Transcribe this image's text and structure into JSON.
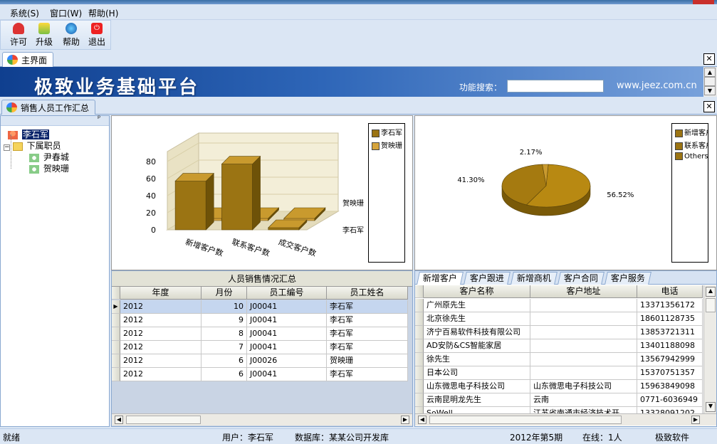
{
  "menu": {
    "items": [
      "系统(S)",
      "窗口(W)",
      "帮助(H)"
    ]
  },
  "toolbar": {
    "buttons": [
      {
        "label": "许可",
        "icon": "license-icon"
      },
      {
        "label": "升级",
        "icon": "upgrade-icon"
      },
      {
        "label": "帮助",
        "icon": "help-icon"
      },
      {
        "label": "退出",
        "icon": "exit-icon"
      }
    ]
  },
  "tabs": {
    "main": "主界面",
    "sub": "销售人员工作汇总"
  },
  "banner": {
    "title": "极致业务基础平台",
    "search_label": "功能搜索：",
    "search_value": "",
    "website": "www.jeez.com.cn"
  },
  "tree": {
    "root": "李石军",
    "group": "下属职员",
    "children": [
      "尹春城",
      "贺映珊"
    ]
  },
  "chart_data": [
    {
      "type": "bar",
      "categories": [
        "新增客户数",
        "联系客户数",
        "成交客户数"
      ],
      "series": [
        {
          "name": "李石军",
          "values": [
            57,
            77,
            2
          ],
          "color": "#9b7413"
        },
        {
          "name": "贺映珊",
          "values": [
            0,
            0,
            0
          ],
          "color": "#d6a43c"
        }
      ],
      "ylim": [
        0,
        80
      ],
      "yticks": [
        0,
        20,
        40,
        60,
        80
      ],
      "series_labels": [
        "贺映珊",
        "李石军"
      ],
      "legend": [
        "李石军",
        "贺映珊"
      ],
      "legend_position": "right",
      "style": "3d"
    },
    {
      "type": "pie",
      "labels": [
        "新增客户",
        "联系客户",
        "Others"
      ],
      "values": [
        56.52,
        41.3,
        2.17
      ],
      "value_labels": [
        "56.52%",
        "41.30%",
        "2.17%"
      ],
      "legend": [
        "新增客户",
        "联系客户",
        "Others"
      ],
      "legend_position": "right",
      "style": "3d"
    }
  ],
  "grid1": {
    "title": "人员销售情况汇总",
    "columns": [
      "年度",
      "月份",
      "员工编号",
      "员工姓名"
    ],
    "rows": [
      [
        "2012",
        "10",
        "J00041",
        "李石军"
      ],
      [
        "2012",
        "9",
        "J00041",
        "李石军"
      ],
      [
        "2012",
        "8",
        "J00041",
        "李石军"
      ],
      [
        "2012",
        "7",
        "J00041",
        "李石军"
      ],
      [
        "2012",
        "6",
        "J00026",
        "贺映珊"
      ],
      [
        "2012",
        "6",
        "J00041",
        "李石军"
      ]
    ],
    "selected_row": 0
  },
  "subtabs": [
    "新增客户",
    "客户跟进",
    "新增商机",
    "客户合同",
    "客户服务"
  ],
  "grid2": {
    "columns": [
      "客户名称",
      "客户地址",
      "电话"
    ],
    "rows": [
      [
        "广州原先生",
        "",
        "13371356172"
      ],
      [
        "北京徐先生",
        "",
        "18601128735"
      ],
      [
        "济宁百易软件科技有限公司",
        "",
        "13853721311"
      ],
      [
        "AD安防&CS智能家居",
        "",
        "13401188098"
      ],
      [
        "徐先生",
        "",
        "13567942999"
      ],
      [
        "日本公司",
        "",
        "15370751357"
      ],
      [
        "山东微思电子科技公司",
        "山东微思电子科技公司",
        "15963849098"
      ],
      [
        "云南昆明龙先生",
        "云南",
        "0771-6036949"
      ],
      [
        "SoWell",
        "江苏省南通市经济技术开",
        "13328091202"
      ]
    ]
  },
  "status": {
    "ready": "就绪",
    "user": "用户：李石军",
    "db": "数据库：某某公司开发库",
    "period": "2012年第5期",
    "online": "在线：1人",
    "brand": "极致软件"
  }
}
